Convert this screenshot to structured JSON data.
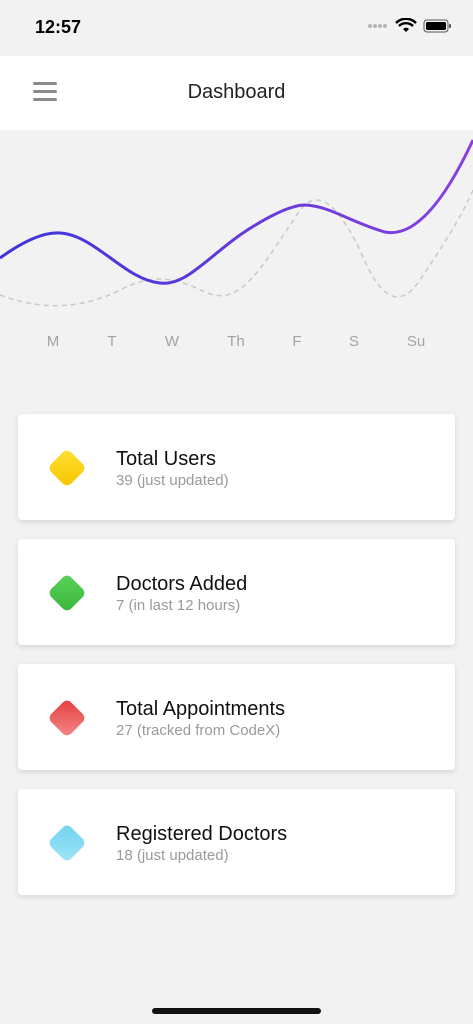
{
  "status_bar": {
    "time": "12:57"
  },
  "header": {
    "title": "Dashboard"
  },
  "chart_data": {
    "type": "line",
    "categories": [
      "M",
      "T",
      "W",
      "Th",
      "F",
      "S",
      "Su"
    ],
    "series": [
      {
        "values": [
          55,
          38,
          30,
          48,
          60,
          52,
          95
        ],
        "color": "#4a3fd6",
        "style": "solid"
      },
      {
        "values": [
          20,
          28,
          35,
          30,
          60,
          20,
          60
        ],
        "color": "#c8c8c8",
        "style": "dashed"
      }
    ],
    "grid": false
  },
  "colors": {
    "yellow": "#f9d71c",
    "green": "#4cc74a",
    "red": "#e44b4b",
    "cyan": "#7fd8f0"
  },
  "cards": [
    {
      "title": "Total Users",
      "subtitle": "39 (just updated)",
      "icon": "yellow-diamond-icon"
    },
    {
      "title": "Doctors Added",
      "subtitle": "7 (in last 12 hours)",
      "icon": "green-diamond-icon"
    },
    {
      "title": "Total Appointments",
      "subtitle": "27 (tracked from CodeX)",
      "icon": "red-diamond-icon"
    },
    {
      "title": "Registered Doctors",
      "subtitle": "18 (just updated)",
      "icon": "cyan-diamond-icon"
    }
  ]
}
